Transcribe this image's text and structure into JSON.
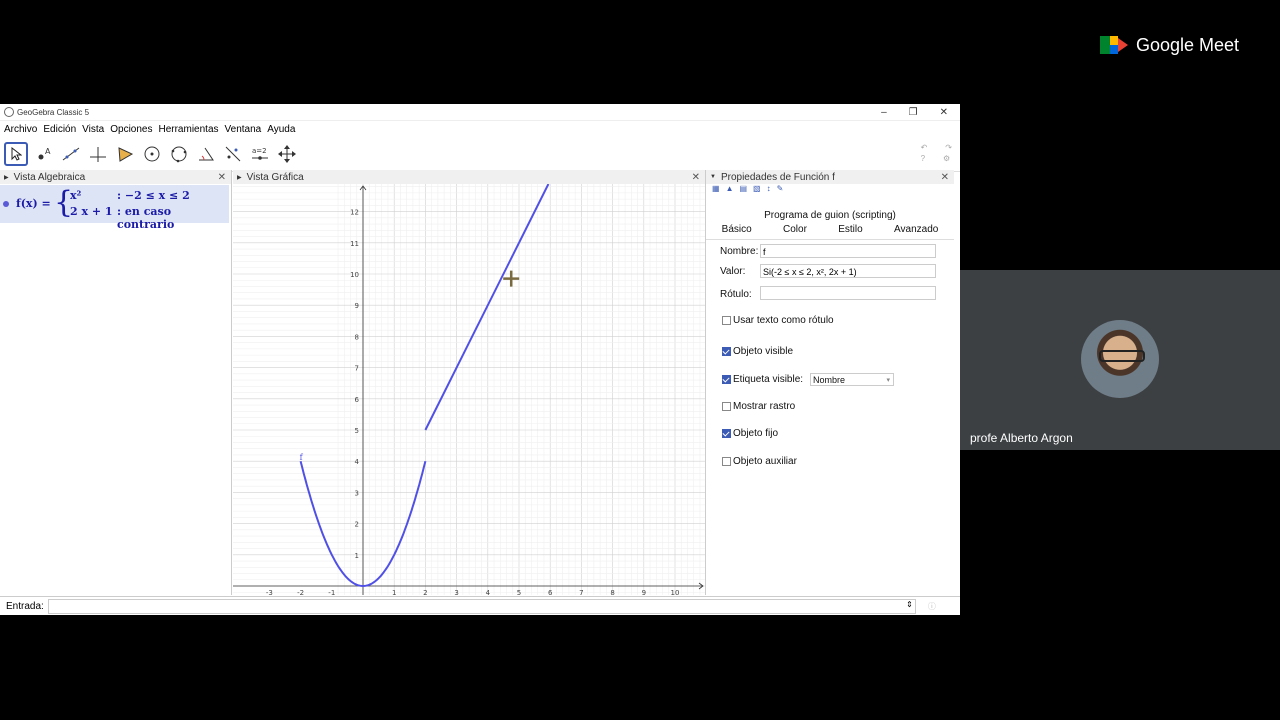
{
  "meet": {
    "brand": "Google Meet",
    "participant_name": "profe Alberto Argon"
  },
  "geogebra": {
    "window_title": "GeoGebra Classic 5",
    "window_buttons": [
      "–",
      "❐",
      "✕"
    ],
    "menu": [
      "Archivo",
      "Edición",
      "Vista",
      "Opciones",
      "Herramientas",
      "Ventana",
      "Ayuda"
    ],
    "tools": [
      "move-tool",
      "point-tool",
      "line-tool",
      "perpendicular-tool",
      "polygon-tool",
      "circle-tool",
      "circle-three-points-tool",
      "angle-tool",
      "reflect-tool",
      "slider-tool",
      "move-view-tool"
    ],
    "slider_tool_label": "a=2",
    "algebra": {
      "header": "Vista Algebraica",
      "lhs": "f(x) =",
      "case1_expr": "x²",
      "case1_cond": ": −2 ≤ x ≤ 2",
      "case2_expr": "2 x + 1",
      "case2_cond": ": en caso contrario"
    },
    "graphics": {
      "header": "Vista Gráfica",
      "function_label": "f",
      "x_ticks": [
        "-3",
        "-2",
        "-1",
        "1",
        "2",
        "3",
        "4",
        "5",
        "6",
        "7",
        "8",
        "9",
        "10"
      ],
      "y_ticks": [
        "1",
        "2",
        "3",
        "4",
        "5",
        "6",
        "7",
        "8",
        "9",
        "10",
        "11",
        "12"
      ],
      "curve_color": "#5050e6"
    },
    "properties": {
      "header": "Propiedades de Función f",
      "scripting_tab": "Programa de guion (scripting)",
      "tabs": [
        "Básico",
        "Color",
        "Estilo",
        "Avanzado"
      ],
      "nombre_label": "Nombre:",
      "nombre_value": "f",
      "valor_label": "Valor:",
      "valor_value": "Si(-2 ≤ x ≤ 2, x², 2x + 1)",
      "rotulo_label": "Rótulo:",
      "rotulo_value": "",
      "checkboxes": [
        {
          "label": "Usar texto como rótulo",
          "checked": false
        },
        {
          "label": "Objeto visible",
          "checked": true
        },
        {
          "label": "Etiqueta visible:",
          "checked": true
        },
        {
          "label": "Mostrar rastro",
          "checked": false
        },
        {
          "label": "Objeto fijo",
          "checked": true
        },
        {
          "label": "Objeto auxiliar",
          "checked": false
        }
      ],
      "etiqueta_option": "Nombre"
    },
    "input_bar": {
      "label": "Entrada:",
      "value": ""
    }
  }
}
